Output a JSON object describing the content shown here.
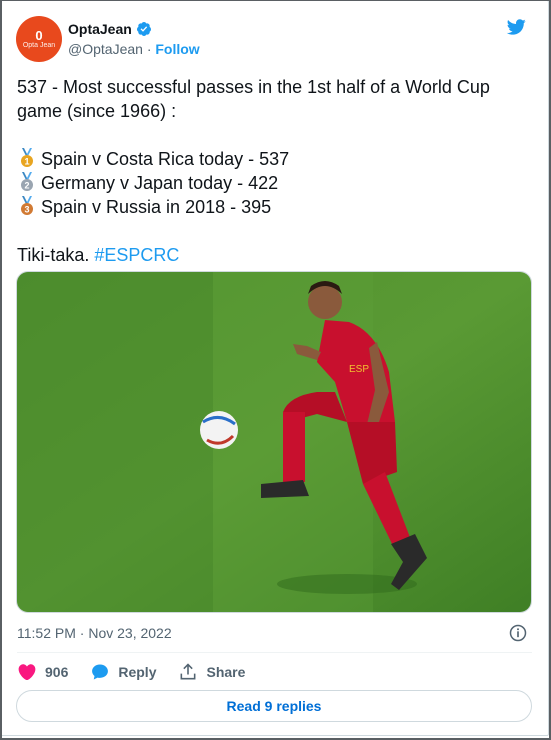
{
  "author": {
    "name": "OptaJean",
    "handle": "@OptaJean",
    "separator": "·",
    "follow_label": "Follow",
    "avatar_text_big": "0",
    "avatar_text_small": "Opta Jean",
    "avatar_color": "#e8491d",
    "verified_icon": "verified-badge-icon"
  },
  "brand_icon": "twitter-bird-icon",
  "tweet": {
    "line1": "537 - Most successful passes in the 1st half of a World Cup",
    "line2": "game (since 1966) :",
    "items": [
      {
        "medal": "1",
        "text": "Spain v Costa Rica today - 537",
        "medal_color": "#e8a521"
      },
      {
        "medal": "2",
        "text": "Germany v Japan today - 422",
        "medal_color": "#9aa5b1"
      },
      {
        "medal": "3",
        "text": "Spain v Russia in 2018 - 395",
        "medal_color": "#d17a33"
      }
    ],
    "closing_text": "Tiki-taka. ",
    "hashtag": "#ESPCRC"
  },
  "timestamp": {
    "time": "11:52 PM",
    "separator": "·",
    "date": "Nov 23, 2022"
  },
  "actions": {
    "like_count": "906",
    "reply_label": "Reply",
    "share_label": "Share"
  },
  "read_replies_label": "Read 9 replies",
  "colors": {
    "link": "#1d9bf0",
    "like": "#f91880",
    "muted": "#536471"
  }
}
